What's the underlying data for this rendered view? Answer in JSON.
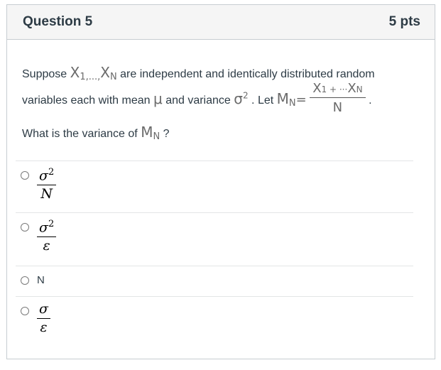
{
  "question": {
    "title": "Question 5",
    "points": "5 pts",
    "text": {
      "part1": "Suppose",
      "x1": "X",
      "seq_sub": "1,...,",
      "xn": "X",
      "xn_sub": "N",
      "part2": "are independent and identically distributed random",
      "part3": "variables each with mean",
      "mu": "μ",
      "part4": "and variance",
      "sigma2": "σ",
      "sigma2_exp": "2",
      "part5": ". Let",
      "mn": "M",
      "mn_sub": "N",
      "eq": "=",
      "frac_num_x1": "X",
      "frac_num_x1_sub": "1",
      "frac_num_mid": " + ···",
      "frac_num_xn": "X",
      "frac_num_xn_sub": "N",
      "frac_den": "N",
      "part6": ".",
      "part7": "What is the variance of",
      "mn2": "M",
      "mn2_sub": "N",
      "part8": "?"
    }
  },
  "answers": [
    {
      "num": "σ",
      "num_exp": "2",
      "den": "N"
    },
    {
      "num": "σ",
      "num_exp": "2",
      "den": "ε"
    },
    {
      "text": "N"
    },
    {
      "num": "σ",
      "den": "ε"
    }
  ]
}
